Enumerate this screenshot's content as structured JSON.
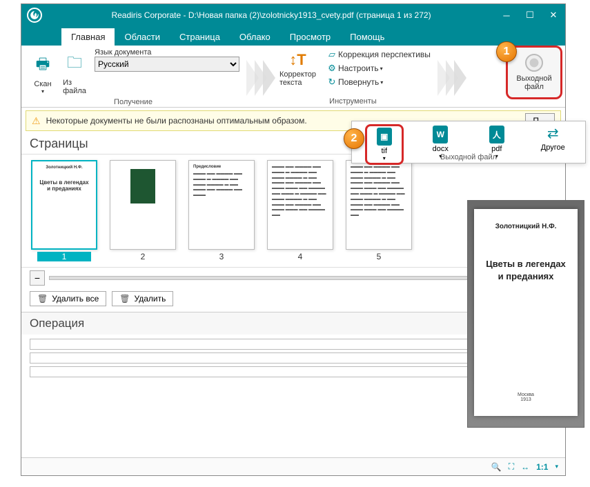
{
  "title": "Readiris Corporate - D:\\Новая папка (2)\\zolotnicky1913_cvety.pdf (страница 1 из 272)",
  "tabs": [
    "Главная",
    "Области",
    "Страница",
    "Облако",
    "Просмотр",
    "Помощь"
  ],
  "ribbon": {
    "scan": "Скан",
    "from_file": "Из\nфайла",
    "lang_label": "Язык документа",
    "lang_value": "Русский",
    "group_get": "Получение",
    "corrector": "Корректор\nтекста",
    "corr_persp": "Коррекция перспективы",
    "adjust": "Настроить",
    "rotate": "Повернуть",
    "group_tools": "Инструменты",
    "out_file": "Выходной\nфайл"
  },
  "callouts": {
    "one": "1",
    "two": "2"
  },
  "msgbar": {
    "warn_icon": "⚠",
    "text": "Некоторые документы не были распознаны оптимальным образом.",
    "btn": "П…"
  },
  "formats": {
    "tif": "tif",
    "docx": "docx",
    "pdf": "pdf",
    "other": "Другое",
    "group": "Выходной файл"
  },
  "pages_title": "Страницы",
  "thumbs": {
    "p1": {
      "author": "Золотницкий Н.Ф.",
      "title": "Цветы в легендах\nи преданиях",
      "num": "1"
    },
    "nums": [
      "2",
      "3",
      "4",
      "5"
    ],
    "p3_heading": "Предисловие"
  },
  "buttons": {
    "del_all": "Удалить все",
    "del": "Удалить"
  },
  "operation": "Операция",
  "preview": {
    "author": "Золотницкий Н.Ф.",
    "title": "Цветы в легендах\nи преданиях",
    "foot_city": "Москва",
    "foot_year": "1913"
  },
  "status": {
    "zoom": "1:1"
  },
  "colors": {
    "accent": "#008a96",
    "highlight": "#d62828"
  }
}
